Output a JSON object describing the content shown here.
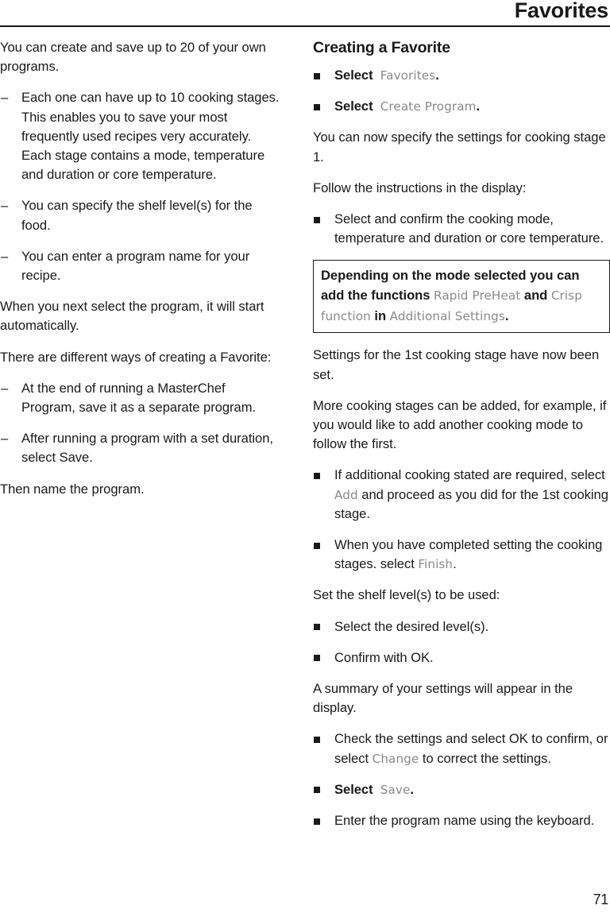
{
  "header": {
    "title": "Favorites"
  },
  "page_number": "71",
  "left_column": {
    "intro": "You can create and save up to 20 of your own programs.",
    "dash_items": [
      "Each one can have up to 10 cooking stages. This enables you to save your most frequently used recipes very accurately. Each stage contains a mode, temperature and duration or core temperature.",
      "You can specify the shelf level(s) for the food.",
      "You can enter a program name for your recipe."
    ],
    "para_auto_start": "When you next select the program, it will start automatically.",
    "para_ways": "There are different ways of creating a Favorite:",
    "dash_items_2": [
      "At the end of running a MasterChef Program, save it as a separate program.",
      "After running a program with a set duration, select Save."
    ],
    "para_then_name": "Then name the program."
  },
  "right_column": {
    "heading": "Creating a Favorite",
    "step_select_favorites": {
      "lead": "Select",
      "display_term": "Favorites",
      "trailing": "."
    },
    "step_select_create_program": {
      "lead": "Select",
      "display_term": "Create Program",
      "trailing": "."
    },
    "para_specify_settings": "You can now specify the settings for cooking stage 1.",
    "para_follow_instructions": "Follow the instructions in the display:",
    "step_select_confirm": "Select and confirm the cooking mode, temperature and duration or core temperature.",
    "note_box": {
      "part1": "Depending on the mode selected you can add the functions ",
      "term1": "Rapid PreHeat",
      "part2": " and ",
      "term2": "Crisp function",
      "part3": " in ",
      "term3": "Additional Settings",
      "part4": "."
    },
    "para_settings_set": "Settings for the 1st cooking stage have now been set.",
    "para_more_stages": "More cooking stages can be added, for example, if you would like to add another cooking mode to follow the first.",
    "step_additional": {
      "part1": "If additional cooking stated are required, select ",
      "term": "Add",
      "part2": " and proceed as you did for the 1st cooking stage."
    },
    "step_completed": {
      "part1": "When you have completed setting the cooking stages. select ",
      "term": "Finish",
      "part2": "."
    },
    "para_set_shelf": "Set the shelf level(s) to be used:",
    "step_select_level": "Select the desired level(s).",
    "step_confirm_ok": "Confirm with OK.",
    "para_summary": "A summary of your settings will appear in the display.",
    "step_check_settings": {
      "part1": "Check the settings and select OK to confirm, or select ",
      "term": "Change",
      "part2": " to correct the settings."
    },
    "step_select_save": {
      "lead": "Select",
      "display_term": "Save",
      "trailing": "."
    },
    "step_enter_name": "Enter the program name using the keyboard."
  }
}
